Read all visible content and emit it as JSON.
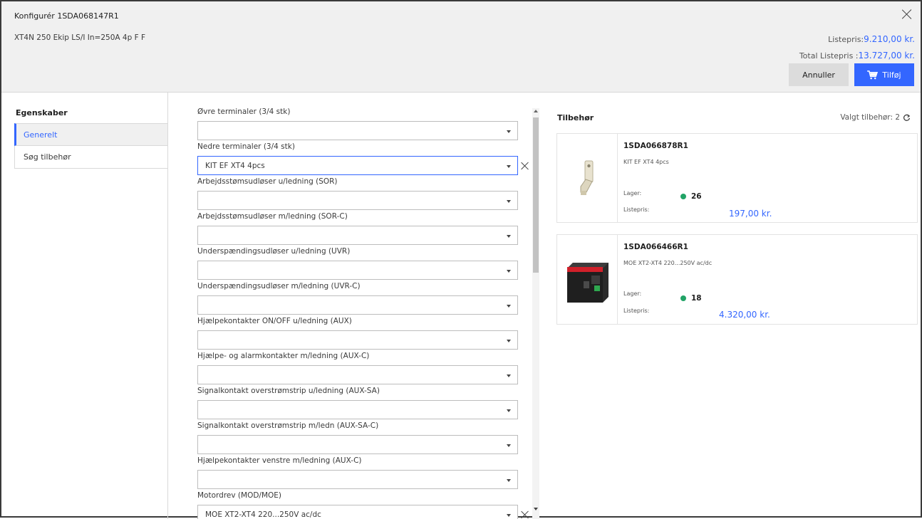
{
  "header": {
    "title": "Konfigurér 1SDA068147R1",
    "subtitle": "XT4N 250 Ekip LS/I In=250A 4p F F",
    "listepris_label": "Listepris:",
    "listepris_value": "9.210,00 kr.",
    "total_label": "Total Listepris :",
    "total_value": "13.727,00 kr.",
    "cancel_label": "Annuller",
    "add_label": "Tilføj"
  },
  "sidebar": {
    "heading": "Egenskaber",
    "items": [
      {
        "label": "Generelt",
        "active": true
      },
      {
        "label": "Søg tilbehør",
        "active": false
      }
    ]
  },
  "form": {
    "fields": [
      {
        "label": "Øvre terminaler (3/4 stk)",
        "value": ""
      },
      {
        "label": "Nedre terminaler (3/4 stk)",
        "value": "KIT EF XT4 4pcs"
      },
      {
        "label": "Arbejdsstømsudløser u/ledning (SOR)",
        "value": ""
      },
      {
        "label": "Arbejdsstømsudløser m/ledning (SOR-C)",
        "value": ""
      },
      {
        "label": "Underspændingsudløser u/ledning (UVR)",
        "value": ""
      },
      {
        "label": "Underspændingsudløser m/ledning (UVR-C)",
        "value": ""
      },
      {
        "label": "Hjælpekontakter ON/OFF u/ledning (AUX)",
        "value": ""
      },
      {
        "label": "Hjælpe- og alarmkontakter m/ledning (AUX-C)",
        "value": ""
      },
      {
        "label": "Signalkontakt overstrømstrip u/ledning (AUX-SA)",
        "value": ""
      },
      {
        "label": "Signalkontakt overstrømstrip m/ledn (AUX-SA-C)",
        "value": ""
      },
      {
        "label": "Hjælpekontakter venstre m/ledning (AUX-C)",
        "value": ""
      },
      {
        "label": "Motordrev (MOD/MOE)",
        "value": "MOE XT2-XT4 220...250V ac/dc"
      }
    ]
  },
  "accessories": {
    "title": "Tilbehør",
    "selected_label": "Valgt tilbehør: 2",
    "items": [
      {
        "code": "1SDA066878R1",
        "description": "KIT EF XT4 4pcs",
        "lager_label": "Lager:",
        "stock": "26",
        "listepris_label": "Listepris:",
        "price": "197,00 kr."
      },
      {
        "code": "1SDA066466R1",
        "description": "MOE XT2-XT4 220...250V ac/dc",
        "lager_label": "Lager:",
        "stock": "18",
        "listepris_label": "Listepris:",
        "price": "4.320,00 kr."
      }
    ]
  },
  "colors": {
    "accent": "#3366ff",
    "stock_ok": "#21a366",
    "header_bg": "#f0f0f0"
  }
}
